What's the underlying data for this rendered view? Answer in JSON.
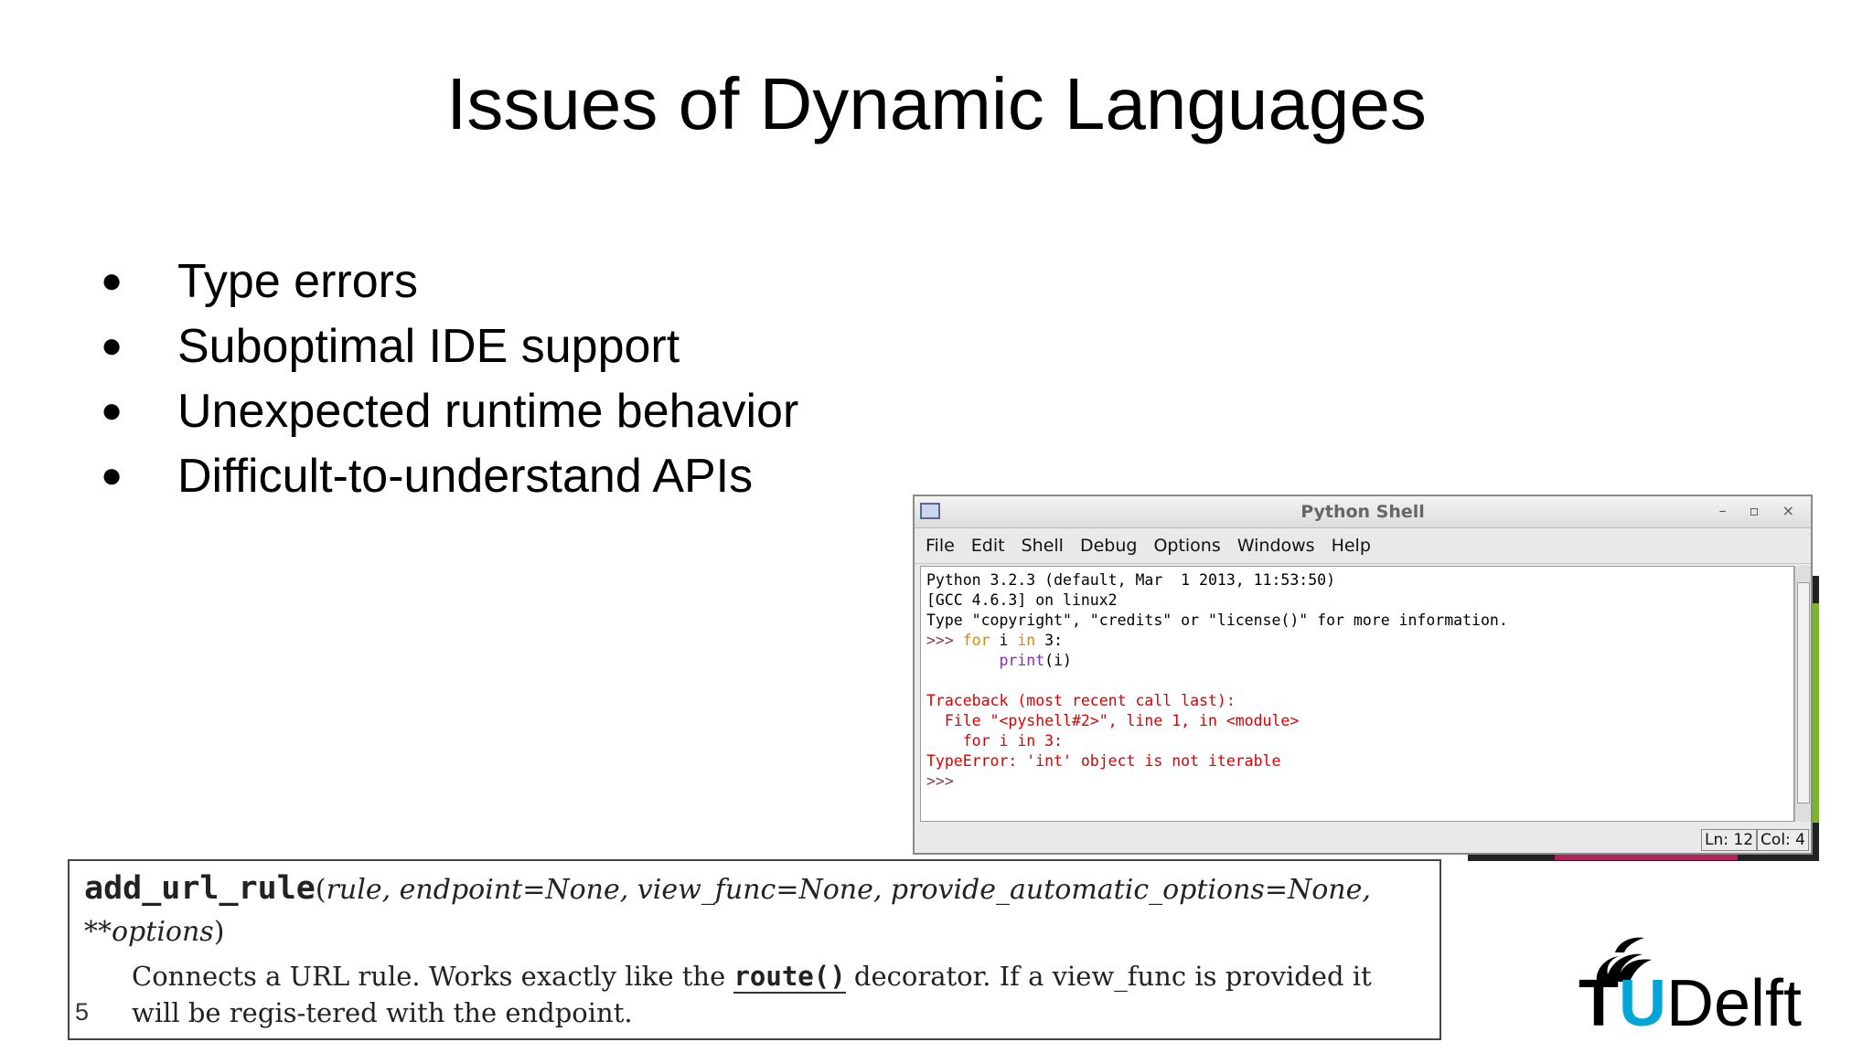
{
  "slide": {
    "title": "Issues of Dynamic Languages",
    "bullets": [
      "Type errors",
      "Suboptimal IDE support",
      "Unexpected runtime behavior",
      "Difficult-to-understand APIs"
    ],
    "page_number": "5"
  },
  "shell": {
    "title": "Python Shell",
    "controls": "– ▫ ×",
    "menu": [
      "File",
      "Edit",
      "Shell",
      "Debug",
      "Options",
      "Windows",
      "Help"
    ],
    "lines": {
      "l1": "Python 3.2.3 (default, Mar  1 2013, 11:53:50)",
      "l2": "[GCC 4.6.3] on linux2",
      "l3": "Type \"copyright\", \"credits\" or \"license()\" for more information.",
      "l4_prompt": ">>> ",
      "l4_for": "for",
      "l4_mid": " i ",
      "l4_in": "in",
      "l4_end": " 3:",
      "l5_indent": "        ",
      "l5_print": "print",
      "l5_end": "(i)",
      "e1": "Traceback (most recent call last):",
      "e2": "  File \"<pyshell#2>\", line 1, in <module>",
      "e3": "    for i in 3:",
      "e4": "TypeError: 'int' object is not iterable",
      "final_prompt": ">>>"
    },
    "status": {
      "ln": "Ln: 12",
      "col": "Col: 4"
    }
  },
  "apidoc": {
    "name": "add_url_rule",
    "open_paren": "(",
    "args": "rule, endpoint=None, view_func=None, provide_automatic_options=None,",
    "args2": "**options",
    "close_paren": ")",
    "desc_before": "Connects a URL rule. Works exactly like the ",
    "desc_code": "route()",
    "desc_after": " decorator. If a view_func is provided it will be regis-tered with the endpoint."
  },
  "logo": {
    "t": "T",
    "u": "U",
    "rest": "Delft"
  }
}
